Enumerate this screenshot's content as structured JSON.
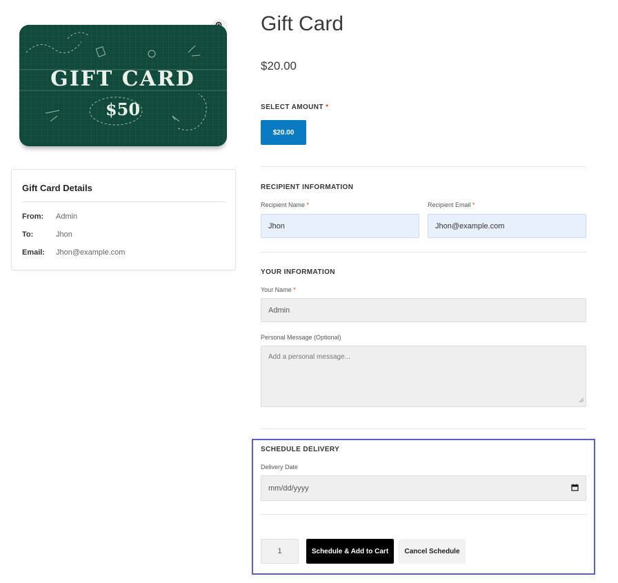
{
  "product": {
    "title": "Gift Card",
    "price": "$20.00",
    "image": {
      "line1": "GIFT CARD",
      "line2": "$50"
    }
  },
  "details": {
    "title": "Gift Card Details",
    "rows": [
      {
        "key": "From:",
        "value": "Admin"
      },
      {
        "key": "To:",
        "value": "Jhon"
      },
      {
        "key": "Email:",
        "value": "Jhon@example.com"
      }
    ]
  },
  "amount": {
    "label": "SELECT AMOUNT",
    "required": "*",
    "option": "$20.00"
  },
  "recipient": {
    "section": "RECIPIENT INFORMATION",
    "name_label": "Recipient Name",
    "name_value": "Jhon",
    "email_label": "Recipient Email",
    "email_value": "Jhon@example.com",
    "required": "*"
  },
  "you": {
    "section": "YOUR INFORMATION",
    "name_label": "Your Name",
    "name_value": "Admin",
    "required": "*",
    "message_label": "Personal Message (Optional)",
    "message_placeholder": "Add a personal message..."
  },
  "schedule": {
    "section": "SCHEDULE DELIVERY",
    "date_label": "Delivery Date",
    "date_placeholder": "mm/dd/yyyy"
  },
  "cart": {
    "quantity": "1",
    "schedule_button": "Schedule & Add to Cart",
    "cancel_button": "Cancel Schedule"
  },
  "colors": {
    "accent": "#0a7bc2",
    "highlight_border": "#5a5fc7",
    "required": "#e2401c",
    "card_green": "#114a3a"
  },
  "icons": {
    "zoom": "zoom-in-icon",
    "calendar": "calendar-icon"
  }
}
